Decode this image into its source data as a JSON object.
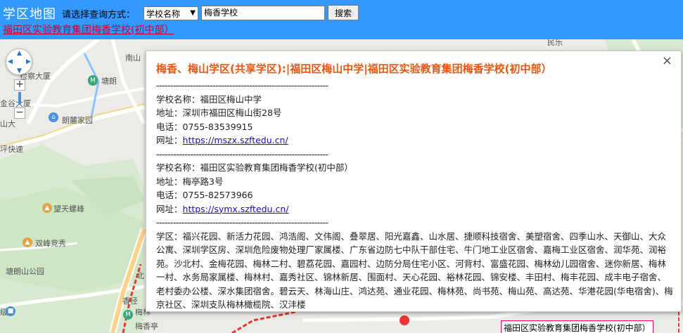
{
  "header": {
    "title": "学区地图",
    "query_label": "请选择查询方式：",
    "query_mode": "学校名称",
    "search_value": "梅香学校",
    "search_button": "搜索",
    "result_link": "福田区实验教育集团梅香学校(初中部）"
  },
  "map": {
    "labels": {
      "nanshan": "南山",
      "court": "检察大厦",
      "tanglang": "塘朗",
      "jingu": "金谷大厦",
      "shan": "山大",
      "langlu": "朗麓家园",
      "ping": "坪快速",
      "wangtian": "望天螺峰",
      "shuangfeng": "双峰竞秀",
      "tanglang_park": "塘朗山公园",
      "minle": "民乐",
      "xiangjing": "香径",
      "meixiang_pavilion": "梅香亭",
      "ji": "级",
      "bei": "北",
      "meilin": "梅林"
    },
    "marker_label": "福田区实验教育集团梅香学校(初中部）"
  },
  "info": {
    "title": "梅香、梅山学区(共享学区):|福田区梅山中学|福田区实验教育集团梅香学校(初中部）",
    "divider": "-------------------------------------------------------------",
    "schools": [
      {
        "name": "学校名称：福田区梅山中学",
        "address": "地址：深圳市福田区梅山街28号",
        "phone": "电话：0755-83539915",
        "site_label": "网址：",
        "site_url": "https://mszx.szftedu.cn/"
      },
      {
        "name": "学校名称：福田区实验教育集团梅香学校(初中部）",
        "address": "地址：梅亭路3号",
        "phone": "电话：0755-82573966",
        "site_label": "网址：",
        "site_url": "https://symx.szftedu.cn/"
      }
    ],
    "zone_text": "学区：福兴花园、新活力花园、鸿浩阁、文伟阁、叠翠居、阳光嘉鑫、山水居、捷顺科技宿舍、美塑宿舍、四季山水、天御山、大众公寓、深圳学区房、深圳危险废物处理厂家属楼、广东省边防七中队干部住宅、牛门地工业区宿舍、嘉梅工业区宿舍、润华苑、润裕苑。沙北村、金梅花园、梅林二村、碧荔花园、嘉园村、边防分局住宅小区、河背村、富盛花园、梅林幼儿园宿舍、迷你新居、梅林一村、水务局家属楼、梅林村、嘉秀社区、锦林新居、围面村、天心花园、裕林花园、锦安楼、丰田村、梅丰花园、成丰电子宿舍、老村委办公楼、深水集团宿舍。碧云天、林海山庄、鸿达苑、通业花园、梅林苑、尚书苑、梅山苑、高达苑、华港花园(华电宿舍)、梅京社区、深圳支队梅林橄榄院、汉沣楼"
  }
}
